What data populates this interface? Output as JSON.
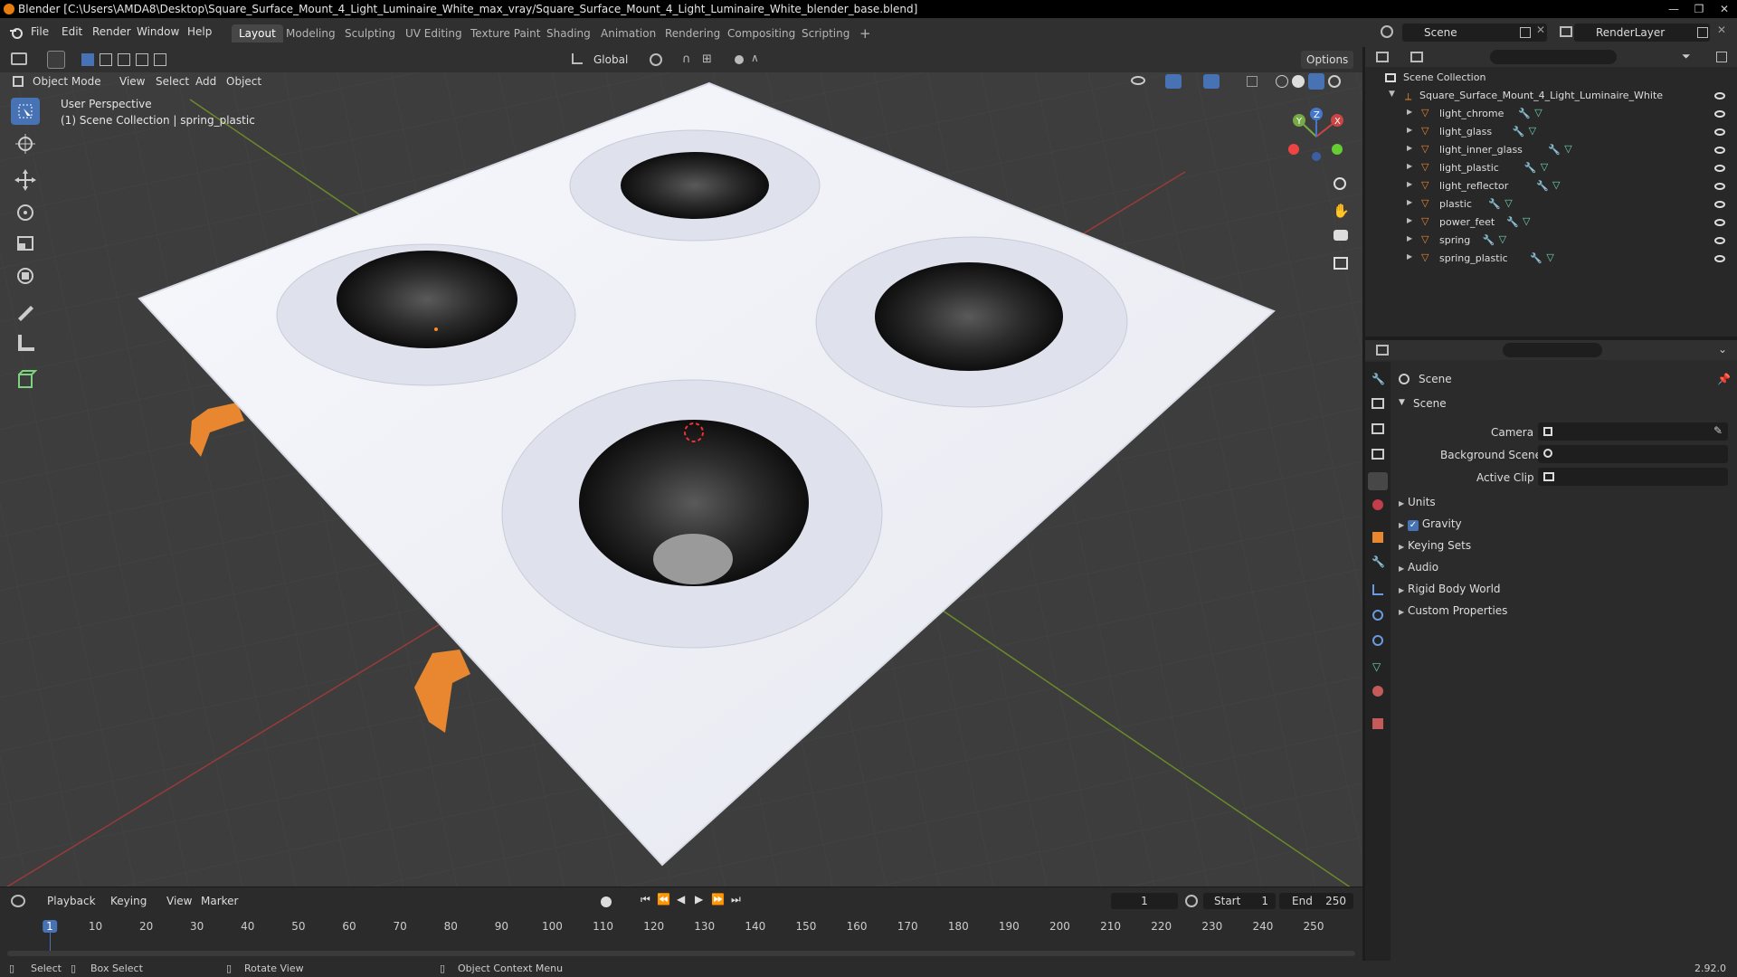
{
  "title_bar": {
    "text": "Blender [C:\\Users\\AMDA8\\Desktop\\Square_Surface_Mount_4_Light_Luminaire_White_max_vray/Square_Surface_Mount_4_Light_Luminaire_White_blender_base.blend]"
  },
  "menu": {
    "file": "File",
    "edit": "Edit",
    "render": "Render",
    "window": "Window",
    "help": "Help"
  },
  "workspaces": [
    "Layout",
    "Modeling",
    "Sculpting",
    "UV Editing",
    "Texture Paint",
    "Shading",
    "Animation",
    "Rendering",
    "Compositing",
    "Scripting"
  ],
  "workspace_add": "+",
  "scene_selector": {
    "value": "Scene"
  },
  "view_layer_selector": {
    "value": "RenderLayer"
  },
  "viewport_header": {
    "mode": "Object Mode",
    "view": "View",
    "select": "Select",
    "add": "Add",
    "object": "Object",
    "orientation": "Global",
    "options": "Options"
  },
  "viewport_overlay": {
    "perspective": "User Perspective",
    "collection_info": "(1) Scene Collection | spring_plastic"
  },
  "outliner": {
    "root": "Scene Collection",
    "collection": "Square_Surface_Mount_4_Light_Luminaire_White",
    "objects": [
      "light_chrome",
      "light_glass",
      "light_inner_glass",
      "light_plastic",
      "light_reflector",
      "plastic",
      "power_feet",
      "spring",
      "spring_plastic"
    ]
  },
  "properties": {
    "header": "Scene",
    "panel": "Scene",
    "camera_label": "Camera",
    "background_label": "Background Scene",
    "active_clip_label": "Active Clip",
    "sections": [
      "Units",
      "Gravity",
      "Keying Sets",
      "Audio",
      "Rigid Body World",
      "Custom Properties"
    ],
    "gravity_checked": true
  },
  "timeline": {
    "playback": "Playback",
    "keying": "Keying",
    "view": "View",
    "marker": "Marker",
    "current_frame": "1",
    "start_label": "Start",
    "start": "1",
    "end_label": "End",
    "end": "250",
    "ticks": [
      "1",
      "10",
      "20",
      "30",
      "40",
      "50",
      "60",
      "70",
      "80",
      "90",
      "100",
      "110",
      "120",
      "130",
      "140",
      "150",
      "160",
      "170",
      "180",
      "190",
      "200",
      "210",
      "220",
      "230",
      "240",
      "250"
    ]
  },
  "status_bar": {
    "select": "Select",
    "box_select": "Box Select",
    "rotate_view": "Rotate View",
    "context_menu": "Object Context Menu",
    "version": "2.92.0"
  },
  "colors": {
    "accent": "#4772b3",
    "object_orange": "#e8872f",
    "mesh_green": "#6ed3b0"
  }
}
